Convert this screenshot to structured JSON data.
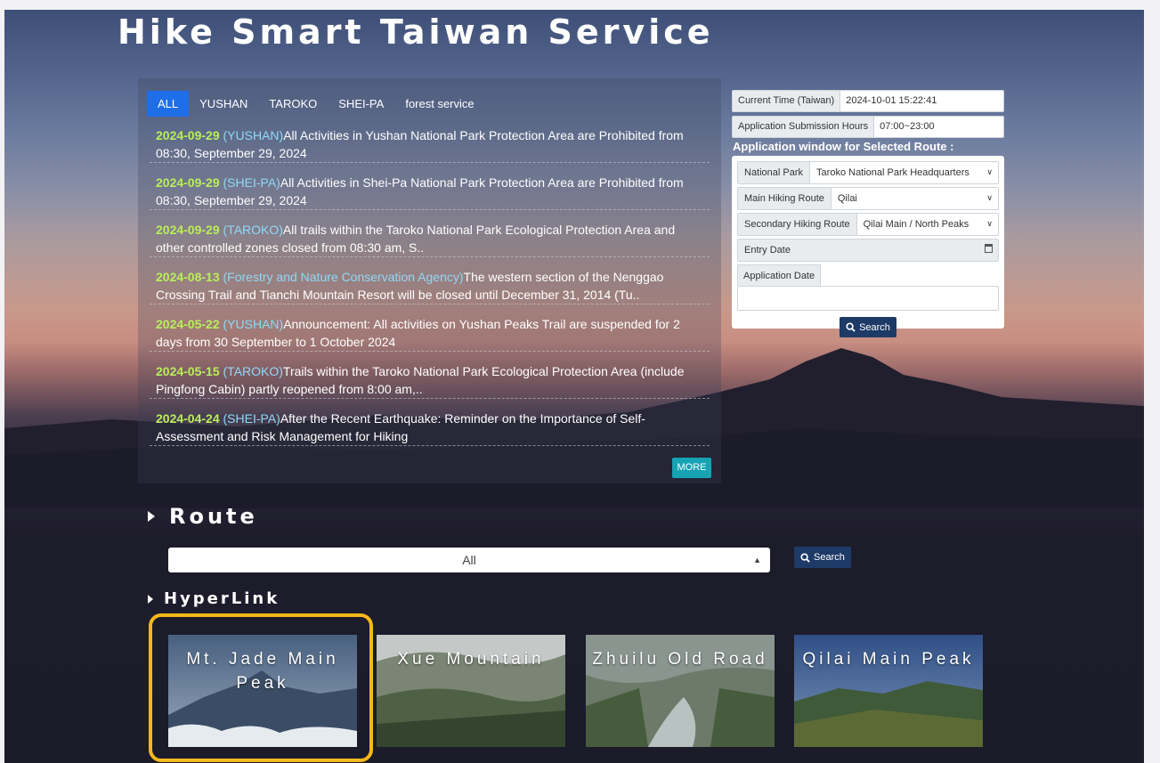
{
  "site": {
    "title": "Hike Smart Taiwan Service"
  },
  "news": {
    "tabs": [
      {
        "label": "ALL",
        "active": true
      },
      {
        "label": "YUSHAN",
        "active": false
      },
      {
        "label": "TAROKO",
        "active": false
      },
      {
        "label": "SHEI-PA",
        "active": false
      },
      {
        "label": "forest service",
        "active": false
      }
    ],
    "items": [
      {
        "date": "2024-09-29",
        "category": "(YUSHAN)",
        "text": "All Activities in Yushan National Park Protection Area are Prohibited from 08:30, September 29, 2024"
      },
      {
        "date": "2024-09-29",
        "category": "(SHEI-PA)",
        "text": "All Activities in Shei-Pa National Park Protection Area are Prohibited from 08:30, September 29, 2024"
      },
      {
        "date": "2024-09-29",
        "category": "(TAROKO)",
        "text": "All trails within the Taroko National Park Ecological Protection Area and other controlled zones closed from 08:30 am, S.."
      },
      {
        "date": "2024-08-13",
        "category": "(Forestry and Nature Conservation Agency)",
        "text": "The western section of the Nenggao Crossing Trail and Tianchi Mountain Resort will be closed until December 31, 2014 (Tu.."
      },
      {
        "date": "2024-05-22",
        "category": "(YUSHAN)",
        "text": "Announcement: All activities on Yushan Peaks Trail are suspended for 2 days from 30 September to 1 October 2024"
      },
      {
        "date": "2024-05-15",
        "category": "(TAROKO)",
        "text": "Trails within the Taroko National Park Ecological Protection Area (include Pingfong Cabin) partly reopened from 8:00 am,.."
      },
      {
        "date": "2024-04-24",
        "category": "(SHEI-PA)",
        "text": "After the Recent Earthquake: Reminder on the Importance of Self-Assessment and Risk Management for Hiking"
      }
    ],
    "more_label": "MORE"
  },
  "application": {
    "current_time_label": "Current Time (Taiwan)",
    "current_time_value": "2024-10-01 15:22:41",
    "submission_hours_label": "Application Submission Hours",
    "submission_hours_value": "07:00~23:00",
    "window_title": "Application window for Selected Route :",
    "national_park_label": "National Park",
    "national_park_value": "Taroko National Park Headquarters",
    "main_route_label": "Main Hiking Route",
    "main_route_value": "Qilai",
    "secondary_route_label": "Secondary Hiking Route",
    "secondary_route_value": "Qilai Main / North Peaks",
    "entry_date_label": "Entry Date",
    "application_date_label": "Application Date",
    "search_label": "Search"
  },
  "route": {
    "title": "Route",
    "select_value": "All",
    "search_label": "Search"
  },
  "hyperlink": {
    "title": "HyperLink",
    "tiles": [
      {
        "label": "Mt. Jade Main Peak",
        "highlighted": true
      },
      {
        "label": "Xue Mountain",
        "highlighted": false
      },
      {
        "label": "Zhuilu Old Road",
        "highlighted": false
      },
      {
        "label": "Qilai Main Peak",
        "highlighted": false
      }
    ]
  },
  "colors": {
    "tab_active": "#1e6ee8",
    "news_date": "#b9ee5a",
    "news_category": "#8fd9f7",
    "more_button": "#16a3b4",
    "search_button": "#1e3a66",
    "highlight_border": "#f5b81a"
  }
}
